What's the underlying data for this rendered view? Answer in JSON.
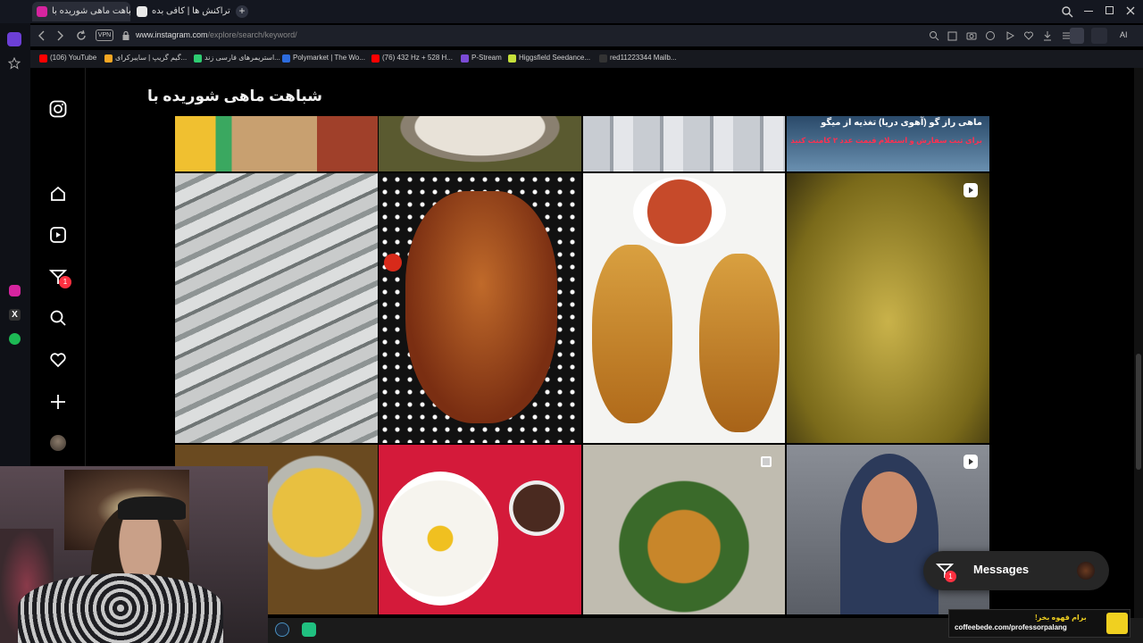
{
  "browser": {
    "tabs": [
      {
        "label": "شباهت ماهی شوریده با",
        "active": true,
        "favicon_color": "#d6249f"
      },
      {
        "label": "تراکنش ها | کافی بده",
        "active": false,
        "favicon_color": "#e8e8e8"
      }
    ],
    "new_tab_label": "+",
    "url_prefix": "www.instagram.com",
    "url_path": "/explore/search/keyword/",
    "vpn_label": "VPN",
    "ai_label": "AI",
    "bookmarks": [
      {
        "label": "(106) YouTube",
        "color": "#ff0000"
      },
      {
        "label": "گیم گریپ | سایبرکرای...",
        "color": "#f5a623"
      },
      {
        "label": "استریمرهای فارسی زند...",
        "color": "#2ecc71"
      },
      {
        "label": "Polymarket | The Wo...",
        "color": "#2d6cdf"
      },
      {
        "label": "(76) 432 Hz + 528 H...",
        "color": "#ff0000"
      },
      {
        "label": "P-Stream",
        "color": "#7b4bd6"
      },
      {
        "label": "Higgsfield Seedance...",
        "color": "#c6e03a"
      },
      {
        "label": "red11223344 Mailb...",
        "color": "#333333"
      }
    ]
  },
  "instagram": {
    "search_title": "شباهت ماهی شوریده با",
    "notification_count": "1",
    "posts_row0": [
      {
        "name": "rice-dish",
        "overlay": ""
      },
      {
        "name": "fish-stew",
        "overlay": ""
      },
      {
        "name": "fish-market",
        "overlay": ""
      },
      {
        "name": "fish-ad",
        "overlay_line1": "ماهی راز گو (آهوی دریا) تغذیه از میگو",
        "overlay_line2": "برای ثبت سفارش و استعلام قیمت عدد ۲ کامنت کنید"
      }
    ],
    "messages": {
      "label": "Messages",
      "badge": "1"
    }
  },
  "overlay": {
    "coffee_line1": "برام قهوه بخر!",
    "coffee_line2": "coffeebede.com/professorpalang"
  }
}
